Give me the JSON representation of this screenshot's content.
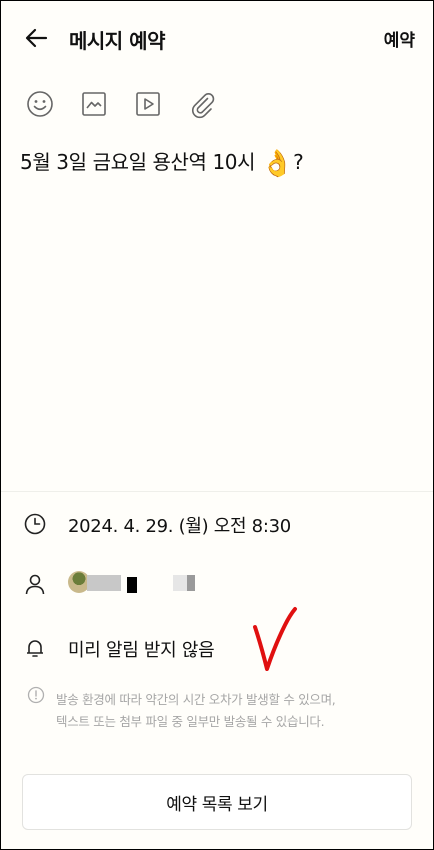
{
  "header": {
    "title": "메시지 예약",
    "reserve_label": "예약"
  },
  "toolbar": {
    "icons": [
      "emoji-icon",
      "image-icon",
      "video-icon",
      "attachment-icon"
    ]
  },
  "message": {
    "text": "5월 3일 금요일 용산역 10시 ",
    "emoji": "👌",
    "suffix": "?"
  },
  "schedule": {
    "datetime": "2024. 4. 29. (월) 오전 8:30"
  },
  "alarm": {
    "label": "미리 알림 받지 않음"
  },
  "notice": {
    "line1": "발송 환경에 따라 약간의 시간 오차가 발생할 수 있으며,",
    "line2": "텍스트 또는 첨부 파일 중 일부만 발송될 수 있습니다."
  },
  "footer": {
    "list_button_label": "예약 목록 보기"
  },
  "colors": {
    "background": "#fffefa",
    "notice_text": "#a6a6a6",
    "annotation": "#e01010"
  }
}
